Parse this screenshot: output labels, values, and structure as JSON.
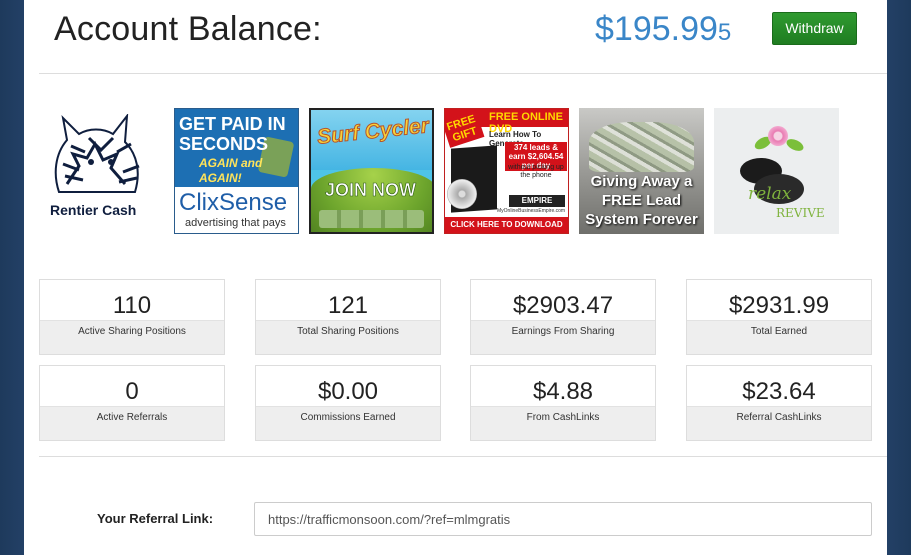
{
  "header": {
    "title": "Account Balance:",
    "balance_main": "$195.99",
    "balance_small": "5",
    "withdraw_label": "Withdraw"
  },
  "banners": {
    "rentier": {
      "name": "Rentier Cash"
    },
    "clixsense": {
      "headline": "GET PAID IN SECONDS",
      "sub": "AGAIN and AGAIN!",
      "logo": "ClixSense",
      "tagline": "advertising that pays"
    },
    "surfcycler": {
      "title": "Surf Cycler",
      "cta": "JOIN NOW"
    },
    "dvd": {
      "top": "FREE ONLINE DVD",
      "gift": "FREE GIFT",
      "learn": "Learn How To Generate",
      "leads": "374 leads & earn $2,604.54 per day",
      "leads_sub": "without picking up the phone",
      "empire": "EMPIRE",
      "site": "MyOnlineBusinessEmpire.com",
      "bottom": "CLICK HERE TO DOWNLOAD NOW!"
    },
    "lead": {
      "text": "Giving Away a FREE Lead System Forever"
    },
    "relax": {
      "relax": "relax",
      "revive": "REVIVE"
    }
  },
  "stats": [
    {
      "value": "110",
      "label": "Active Sharing Positions"
    },
    {
      "value": "121",
      "label": "Total Sharing Positions"
    },
    {
      "value": "$2903.47",
      "label": "Earnings From Sharing"
    },
    {
      "value": "$2931.99",
      "label": "Total Earned"
    },
    {
      "value": "0",
      "label": "Active Referrals"
    },
    {
      "value": "$0.00",
      "label": "Commissions Earned"
    },
    {
      "value": "$4.88",
      "label": "From CashLinks"
    },
    {
      "value": "$23.64",
      "label": "Referral CashLinks"
    }
  ],
  "referral": {
    "label": "Your Referral Link:",
    "url": "https://trafficmonsoon.com/?ref=mlmgratis"
  },
  "colors": {
    "balance": "#3a86c8",
    "withdraw": "#2a8f2b",
    "page_bg": "#1e3a5c"
  }
}
